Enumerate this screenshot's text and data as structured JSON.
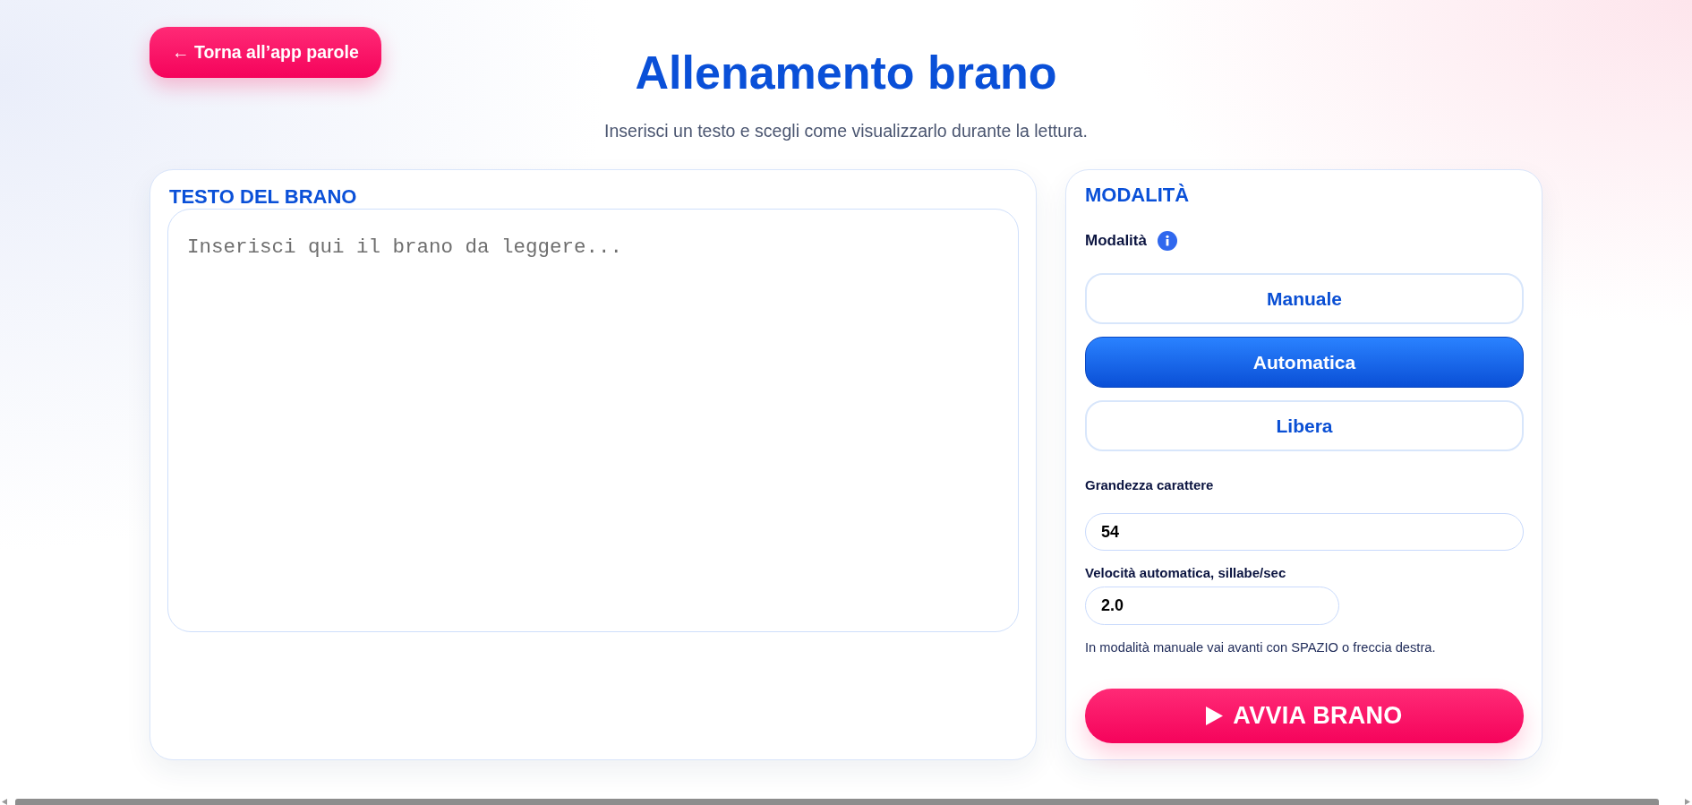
{
  "back_button": {
    "label": "← Torna all’app parole"
  },
  "header": {
    "title": "Allenamento brano",
    "subtitle": "Inserisci un testo e scegli come visualizzarlo durante la lettura."
  },
  "text_panel": {
    "heading": "TESTO DEL BRANO",
    "textarea": {
      "placeholder": "Inserisci qui il brano da leggere..."
    }
  },
  "mode_panel": {
    "heading": "MODALITÀ",
    "mode_label": "Modalità",
    "modes": [
      {
        "label": "Manuale",
        "selected": false
      },
      {
        "label": "Automatica",
        "selected": true
      },
      {
        "label": "Libera",
        "selected": false
      }
    ],
    "font_size": {
      "label": "Grandezza carattere",
      "value": "54"
    },
    "speed": {
      "label": "Velocità automatica, sillabe/sec",
      "value": "2.0"
    },
    "hint": "In modalità manuale vai avanti con SPAZIO o freccia destra.",
    "start_button": {
      "label": "AVVIA BRANO"
    }
  }
}
